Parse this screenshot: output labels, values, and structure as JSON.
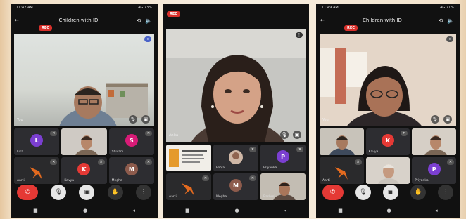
{
  "phones": [
    {
      "status_time": "11:42 AM",
      "status_right": "4G 73%",
      "title": "Children with ID",
      "rec_label": "REC",
      "main_name": "You",
      "tiles": [
        {
          "name": "Lisa",
          "avatar": "L",
          "color": "#7b3fd1"
        },
        {
          "name": "",
          "avatar": "",
          "color": ""
        },
        {
          "name": "Shivani",
          "avatar": "S",
          "color": "#d81b77"
        },
        {
          "name": "Aarti",
          "avatar": "",
          "color": ""
        },
        {
          "name": "Kavya",
          "avatar": "K",
          "color": "#e53935"
        },
        {
          "name": "Megha",
          "avatar": "M",
          "color": "#8d5b4c"
        }
      ]
    },
    {
      "rec_label": "REC",
      "main_name": "Anita",
      "tiles": [
        {
          "name": "",
          "avatar": "",
          "color": ""
        },
        {
          "name": "Pooja",
          "avatar": "",
          "color": ""
        },
        {
          "name": "Priyanka",
          "avatar": "P",
          "color": "#7b3fd1"
        },
        {
          "name": "Aarti",
          "avatar": "",
          "color": ""
        },
        {
          "name": "Megha",
          "avatar": "M",
          "color": "#8d5b4c"
        },
        {
          "name": "Rashmi",
          "avatar": "",
          "color": ""
        }
      ]
    },
    {
      "status_time": "11:49 AM",
      "status_right": "4G 71%",
      "title": "Children with ID",
      "rec_label": "REC",
      "main_name": "You",
      "tiles": [
        {
          "name": "",
          "avatar": "",
          "color": ""
        },
        {
          "name": "Kavya",
          "avatar": "K",
          "color": "#e53935"
        },
        {
          "name": "",
          "avatar": "",
          "color": ""
        },
        {
          "name": "Aarti",
          "avatar": "",
          "color": ""
        },
        {
          "name": "",
          "avatar": "",
          "color": ""
        },
        {
          "name": "Priyanka",
          "avatar": "P",
          "color": "#7b3fd1"
        }
      ]
    }
  ],
  "icons": {
    "back": "←",
    "camera_flip": "⟲",
    "speaker": "🔈",
    "end_call": "✆",
    "mic": "🎙",
    "camera": "▣",
    "hand": "✋",
    "more": "⋮",
    "nav_home": "■",
    "nav_circle": "●",
    "nav_back": "◂"
  }
}
